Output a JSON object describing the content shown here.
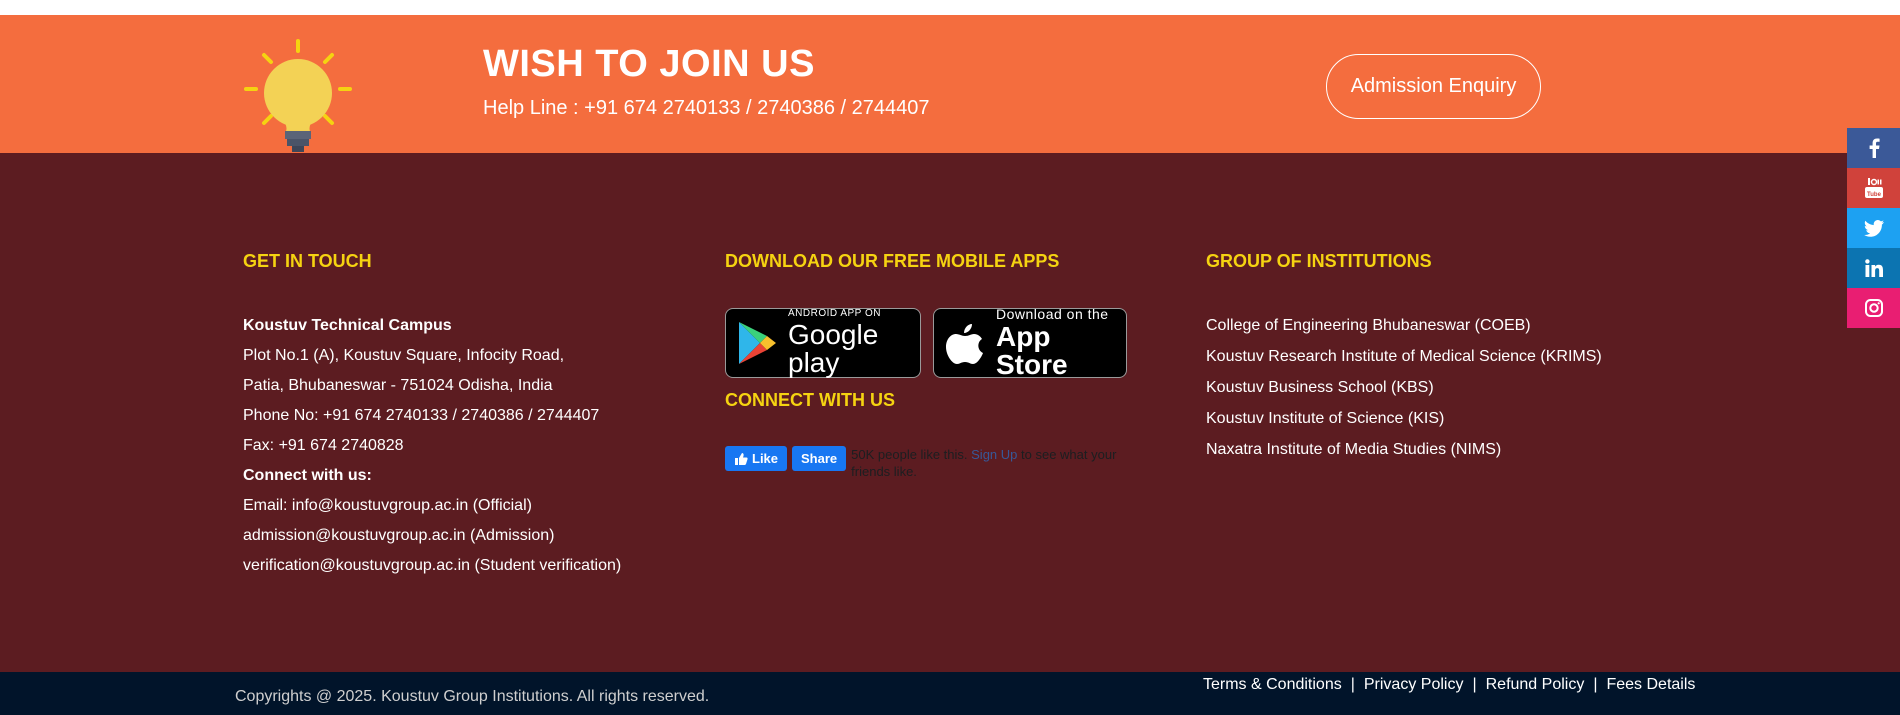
{
  "banner": {
    "title": "WISH TO JOIN US",
    "helpline": "Help Line : +91 674 2740133 / 2740386 / 2744407",
    "button_label": "Admission Enquiry",
    "icon": "lightbulb-icon",
    "bg_color": "#f46d3e"
  },
  "footer": {
    "bg_color": "#5c1c21",
    "heading_color": "#f5d311",
    "get_in_touch": {
      "heading": "GET IN TOUCH",
      "campus_name": "Koustuv Technical Campus",
      "address_line1": "Plot No.1 (A), Koustuv Square, Infocity Road,",
      "address_line2": "Patia, Bhubaneswar - 751024 Odisha, India",
      "phone": "Phone No: +91 674 2740133 / 2740386 / 2744407",
      "fax": "Fax: +91 674 2740828",
      "connect_label": "Connect with us:",
      "email_official": "Email: info@koustuvgroup.ac.in (Official)",
      "email_admission": "admission@koustuvgroup.ac.in (Admission)",
      "email_verification": "verification@koustuvgroup.ac.in (Student verification)"
    },
    "apps": {
      "heading": "DOWNLOAD OUR FREE MOBILE APPS",
      "google_play": {
        "small": "ANDROID APP ON",
        "big": "Google play"
      },
      "app_store": {
        "small": "Download on the",
        "big": "App Store"
      }
    },
    "connect": {
      "heading": "CONNECT WITH US",
      "like_label": "Like",
      "share_label": "Share",
      "fb_text_before": "50K people like this.",
      "fb_signup": "Sign Up",
      "fb_text_after": "to see what your friends like."
    },
    "institutions": {
      "heading": "GROUP OF INSTITUTIONS",
      "items": [
        "College of Engineering Bhubaneswar (COEB)",
        "Koustuv Research Institute of Medical Science (KRIMS)",
        "Koustuv Business School (KBS)",
        "Koustuv Institute of Science (KIS)",
        "Naxatra Institute of Media Studies (NIMS)"
      ]
    }
  },
  "bottom_bar": {
    "copyright": "Copyrights @ 2025. Koustuv Group Institutions. All rights reserved.",
    "links": [
      "Terms & Conditions",
      "Privacy Policy",
      "Refund Policy",
      "Fees Details"
    ]
  },
  "social": {
    "items": [
      {
        "icon": "facebook-icon",
        "color": "#3b5998"
      },
      {
        "icon": "youtube-icon",
        "color": "#d0423b"
      },
      {
        "icon": "twitter-icon",
        "color": "#1da1f2"
      },
      {
        "icon": "linkedin-icon",
        "color": "#0c74b1"
      },
      {
        "icon": "instagram-icon",
        "color": "#e91e72"
      }
    ]
  }
}
